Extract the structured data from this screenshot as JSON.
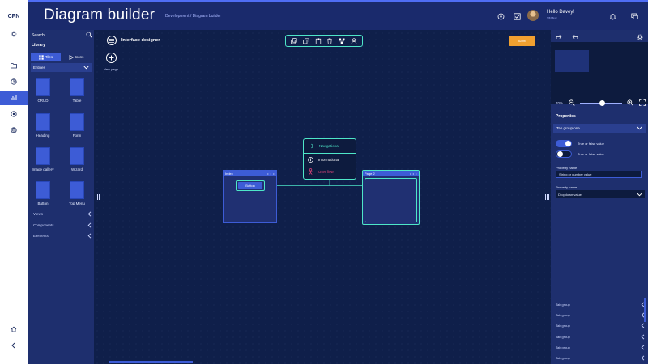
{
  "rail": {
    "brand": "CPN"
  },
  "header": {
    "title": "Diagram builder",
    "breadcrumb": "Development / Diagram builder",
    "greeting": "Hello Davey!",
    "status": "Status"
  },
  "library": {
    "search_label": "Search",
    "title": "Library",
    "tab_tiles": "Tiles",
    "tab_icons": "Icons",
    "section": "Entities",
    "tiles": [
      "CRUD",
      "Table",
      "Heading",
      "Form",
      "Image gallery",
      "Wizard",
      "Button",
      "Top Menu"
    ],
    "groups": [
      "Views",
      "Components",
      "Elements"
    ]
  },
  "canvas": {
    "title": "Interface designer",
    "new_page": "New page",
    "save": "Save",
    "node_index": "Index",
    "node_button": "Button",
    "node_page2": "Page 2",
    "link_menu": {
      "navigational": "Navigational",
      "informational": "Informational",
      "user_flow": "User flow"
    }
  },
  "properties": {
    "zoom": "70%",
    "title": "Properties",
    "tab_group_open": "Tab group one",
    "toggle_1_label": "True or false value",
    "toggle_2_label": "True or false value",
    "property_name_1": "Property name",
    "string_value": "String or number value",
    "property_name_2": "Property name",
    "dropdown_value": "Dropdown value",
    "tab_groups": [
      "Tab group",
      "Tab group",
      "Tab group",
      "Tab group",
      "Tab group",
      "Tab group"
    ]
  },
  "colors": {
    "accent": "#3d5cd6",
    "teal": "#4ee6c8",
    "save": "#f0a030",
    "user_flow": "#e0457a"
  }
}
